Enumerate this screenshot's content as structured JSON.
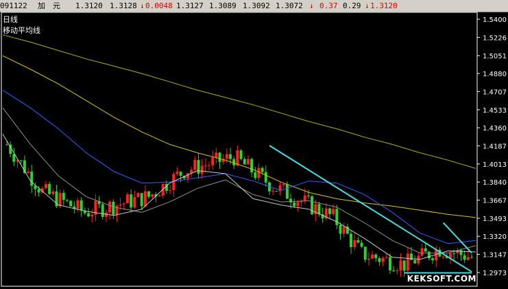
{
  "quote_bar": {
    "date": "091122",
    "instrument": "加　元",
    "open": "1.3120",
    "high": "1.3128",
    "change_arrow": "↓",
    "change": "0.0048",
    "low": "1.3127",
    "close": "1.3089",
    "bid": "1.3092",
    "ask": "1.3072",
    "pct_arrow": "↓",
    "pct": "0.37",
    "spread": "0.29",
    "last_arrow": "↓",
    "last": "1.3120"
  },
  "chart_labels": {
    "period": "日线",
    "indicator": "移动平均线"
  },
  "watermark": "KEKSOFT.COM",
  "colors": {
    "background": "#000000",
    "axis": "#ffffff",
    "candle_up": "#ff2020",
    "candle_down": "#30d030",
    "trendline": "#40e0e0",
    "ma_long": "#b0b000",
    "ma_mid": "#d8c800",
    "ma_blue": "#3060ff",
    "ma_white": "#c8c8c8",
    "ma_grey": "#909090"
  },
  "chart_data": {
    "type": "candlestick",
    "y_ticks": [
      "1.5400",
      "1.5226",
      "1.5051",
      "1.4880",
      "1.4707",
      "1.4533",
      "1.4360",
      "1.4187",
      "1.4013",
      "1.3840",
      "1.3667",
      "1.3493",
      "1.3320",
      "1.3147",
      "1.2973"
    ],
    "ylim": [
      1.2973,
      1.54
    ],
    "x_count": 132,
    "candles_seed": 7,
    "key_closes": [
      {
        "i": 0,
        "v": 1.42
      },
      {
        "i": 10,
        "v": 1.375
      },
      {
        "i": 22,
        "v": 1.355
      },
      {
        "i": 40,
        "v": 1.37
      },
      {
        "i": 50,
        "v": 1.395
      },
      {
        "i": 64,
        "v": 1.408
      },
      {
        "i": 75,
        "v": 1.38
      },
      {
        "i": 92,
        "v": 1.35
      },
      {
        "i": 100,
        "v": 1.315
      },
      {
        "i": 112,
        "v": 1.305
      },
      {
        "i": 122,
        "v": 1.32
      },
      {
        "i": 131,
        "v": 1.312
      }
    ],
    "moving_averages": [
      {
        "name": "MA-long",
        "color_key": "ma_long",
        "values": [
          1.525,
          1.518,
          1.51,
          1.502,
          1.495,
          1.488,
          1.48,
          1.472,
          1.465,
          1.458,
          1.45,
          1.442,
          1.435,
          1.427,
          1.42,
          1.412,
          1.405,
          1.397
        ]
      },
      {
        "name": "MA-mid",
        "color_key": "ma_mid",
        "values": [
          1.505,
          1.492,
          1.478,
          1.462,
          1.446,
          1.432,
          1.42,
          1.412,
          1.405,
          1.396,
          1.384,
          1.374,
          1.368,
          1.364,
          1.361,
          1.357,
          1.353,
          1.35
        ]
      },
      {
        "name": "MA-blue",
        "color_key": "ma_blue",
        "values": [
          1.472,
          1.455,
          1.435,
          1.412,
          1.394,
          1.383,
          1.384,
          1.388,
          1.392,
          1.385,
          1.376,
          1.385,
          1.383,
          1.372,
          1.355,
          1.335,
          1.325,
          1.328
        ]
      },
      {
        "name": "MA-grey",
        "color_key": "ma_grey",
        "values": [
          1.455,
          1.42,
          1.39,
          1.37,
          1.36,
          1.355,
          1.365,
          1.378,
          1.386,
          1.372,
          1.365,
          1.366,
          1.36,
          1.345,
          1.328,
          1.316,
          1.316,
          1.323
        ]
      },
      {
        "name": "MA-white",
        "color_key": "ma_white",
        "values": [
          1.43,
          1.385,
          1.362,
          1.356,
          1.352,
          1.358,
          1.383,
          1.395,
          1.392,
          1.368,
          1.362,
          1.358,
          1.346,
          1.33,
          1.312,
          1.31,
          1.318,
          1.317
        ]
      }
    ],
    "trendlines": [
      {
        "from": {
          "i": 74,
          "v": 1.419
        },
        "to": {
          "i": 131,
          "v": 1.298
        }
      },
      {
        "from": {
          "i": 123,
          "v": 1.345
        },
        "to": {
          "i": 131,
          "v": 1.316
        }
      },
      {
        "from": {
          "i": 112,
          "v": 1.297
        },
        "to": {
          "i": 131,
          "v": 1.297
        }
      }
    ]
  }
}
